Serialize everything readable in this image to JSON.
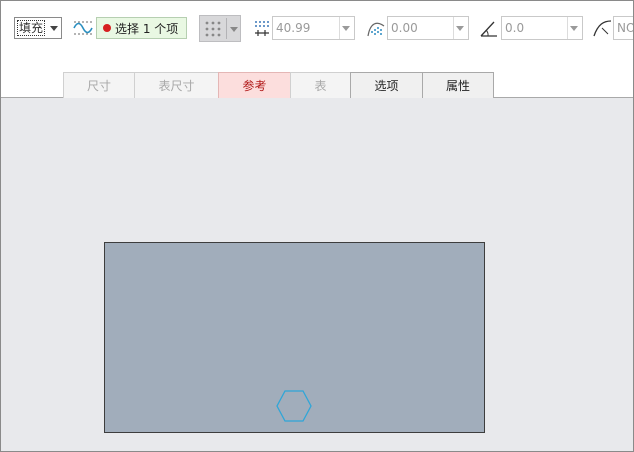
{
  "toolbar": {
    "mode_select": {
      "value": "填充"
    },
    "selection_button": {
      "label": "选择 1 个项",
      "status_color": "#d62020"
    },
    "grid_button": {
      "icon": "dot-grid-icon"
    },
    "offset_field": {
      "value": "40.99",
      "icon": "hatch-spacing-icon"
    },
    "density_field": {
      "value": "0.00",
      "icon": "hatch-pattern-icon"
    },
    "angle_field": {
      "value": "0.0",
      "icon": "angle-icon"
    },
    "extra_field": {
      "value": "NO",
      "icon": "curve-icon"
    }
  },
  "tabs": [
    {
      "label": "尺寸",
      "state": "disabled"
    },
    {
      "label": "表尺寸",
      "state": "disabled"
    },
    {
      "label": "参考",
      "state": "active"
    },
    {
      "label": "表",
      "state": "disabled"
    },
    {
      "label": "选项",
      "state": "normal"
    },
    {
      "label": "属性",
      "state": "normal"
    }
  ],
  "canvas": {
    "fill_color": "#a1adbb",
    "marker_color": "#2fa6d8"
  }
}
